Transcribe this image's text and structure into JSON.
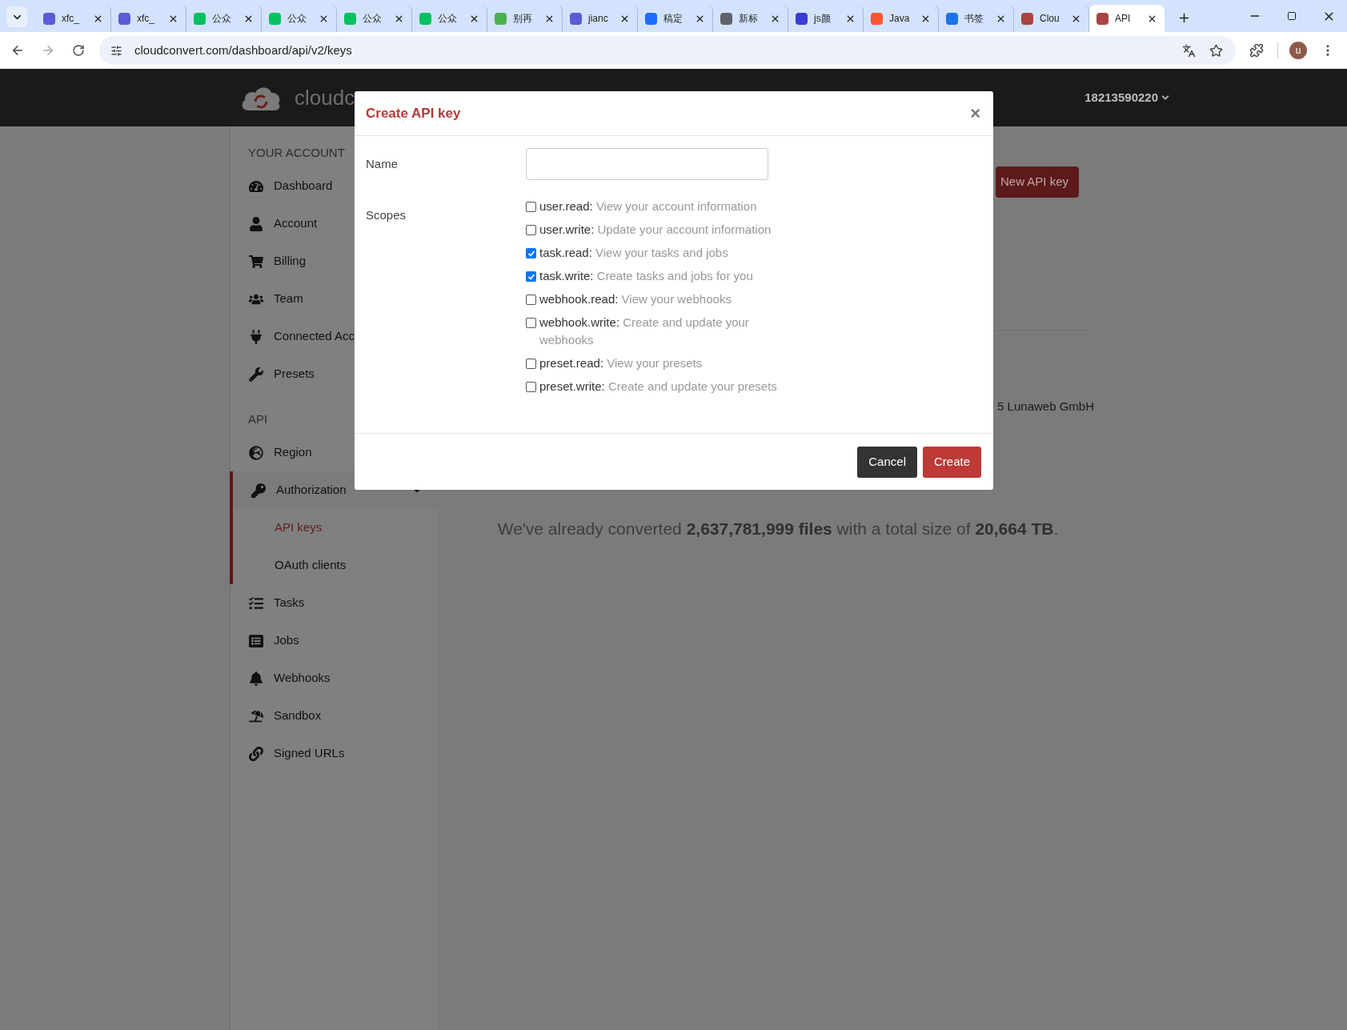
{
  "browser": {
    "tabs": [
      {
        "title": "xfc_",
        "color": "#5b5bd6",
        "selected": false
      },
      {
        "title": "xfc_",
        "color": "#5b5bd6",
        "selected": false
      },
      {
        "title": "公众",
        "color": "#07c160",
        "selected": false
      },
      {
        "title": "公众",
        "color": "#07c160",
        "selected": false
      },
      {
        "title": "公众",
        "color": "#07c160",
        "selected": false
      },
      {
        "title": "公众",
        "color": "#07c160",
        "selected": false
      },
      {
        "title": "别再",
        "color": "#4caf50",
        "selected": false
      },
      {
        "title": "jianc",
        "color": "#5b5bd6",
        "selected": false
      },
      {
        "title": "稿定",
        "color": "#1a6dff",
        "selected": false
      },
      {
        "title": "新标",
        "color": "#5f6368",
        "selected": false
      },
      {
        "title": "js颜",
        "color": "#3b3bd6",
        "selected": false
      },
      {
        "title": "Java",
        "color": "#fc5531",
        "selected": false
      },
      {
        "title": "书签",
        "color": "#1a73e8",
        "selected": false
      },
      {
        "title": "Clou",
        "color": "#a94442",
        "selected": false
      },
      {
        "title": "API",
        "color": "#a94442",
        "selected": true
      }
    ],
    "address": "cloudconvert.com/dashboard/api/v2/keys",
    "profile_initial": "u"
  },
  "header": {
    "logo_text": "cloudc",
    "user": "18213590220"
  },
  "sidebar": {
    "sections": [
      {
        "heading": "YOUR ACCOUNT",
        "items": [
          {
            "label": "Dashboard"
          },
          {
            "label": "Account"
          },
          {
            "label": "Billing"
          },
          {
            "label": "Team"
          },
          {
            "label": "Connected Acc"
          },
          {
            "label": "Presets"
          }
        ]
      },
      {
        "heading": "API",
        "items": [
          {
            "label": "Region"
          },
          {
            "label": "Authorization",
            "expanded": true,
            "children": [
              {
                "label": "API keys",
                "selected": true
              },
              {
                "label": "OAuth clients",
                "selected": false
              }
            ]
          },
          {
            "label": "Tasks"
          },
          {
            "label": "Jobs"
          },
          {
            "label": "Webhooks"
          },
          {
            "label": "Sandbox"
          },
          {
            "label": "Signed URLs"
          }
        ]
      }
    ]
  },
  "content": {
    "new_key_button": "New API key",
    "footer": "5 Lunaweb GmbH",
    "stats": "We've already converted **2,637,781,999 files** with a total size of **20,664 TB**."
  },
  "modal": {
    "title": "Create API key",
    "close": "×",
    "name_label": "Name",
    "scopes_label": "Scopes",
    "scopes": [
      {
        "name": "user.read:",
        "description": "View your account information",
        "checked": false
      },
      {
        "name": "user.write:",
        "description": "Update your account information",
        "checked": false
      },
      {
        "name": "task.read:",
        "description": "View your tasks and jobs",
        "checked": true
      },
      {
        "name": "task.write:",
        "description": "Create tasks and jobs for you",
        "checked": true
      },
      {
        "name": "webhook.read:",
        "description": "View your webhooks",
        "checked": false
      },
      {
        "name": "webhook.write:",
        "description": "Create and update your webhooks",
        "checked": false
      },
      {
        "name": "preset.read:",
        "description": "View your presets",
        "checked": false
      },
      {
        "name": "preset.write:",
        "description": "Create and update your presets",
        "checked": false
      }
    ],
    "buttons": [
      {
        "label": "Cancel",
        "kind": "secondary"
      },
      {
        "label": "Create",
        "kind": "primary"
      }
    ]
  }
}
